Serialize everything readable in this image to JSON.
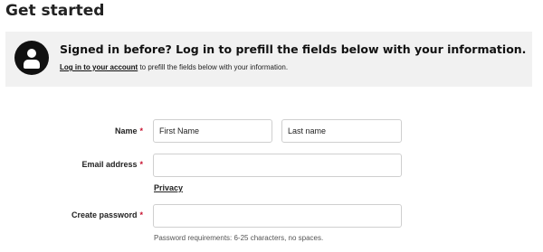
{
  "page": {
    "title": "Get started"
  },
  "banner": {
    "icon": "user-avatar-icon",
    "heading": "Signed in before? Log in to prefill the fields below with your information.",
    "login_link": "Log in to your account",
    "sub_text": " to prefill the fields below with your information."
  },
  "form": {
    "name_label": "Name",
    "first_name_placeholder": "First Name",
    "last_name_placeholder": "Last name",
    "email_label": "Email address",
    "email_value": "",
    "privacy_link": "Privacy",
    "password_label": "Create password",
    "password_value": "",
    "password_hint": "Password requirements: 6-25 characters, no spaces.",
    "required_marker": "*"
  },
  "colors": {
    "banner_bg": "#f1f1f1",
    "required": "#c8102e",
    "avatar": "#111111"
  }
}
